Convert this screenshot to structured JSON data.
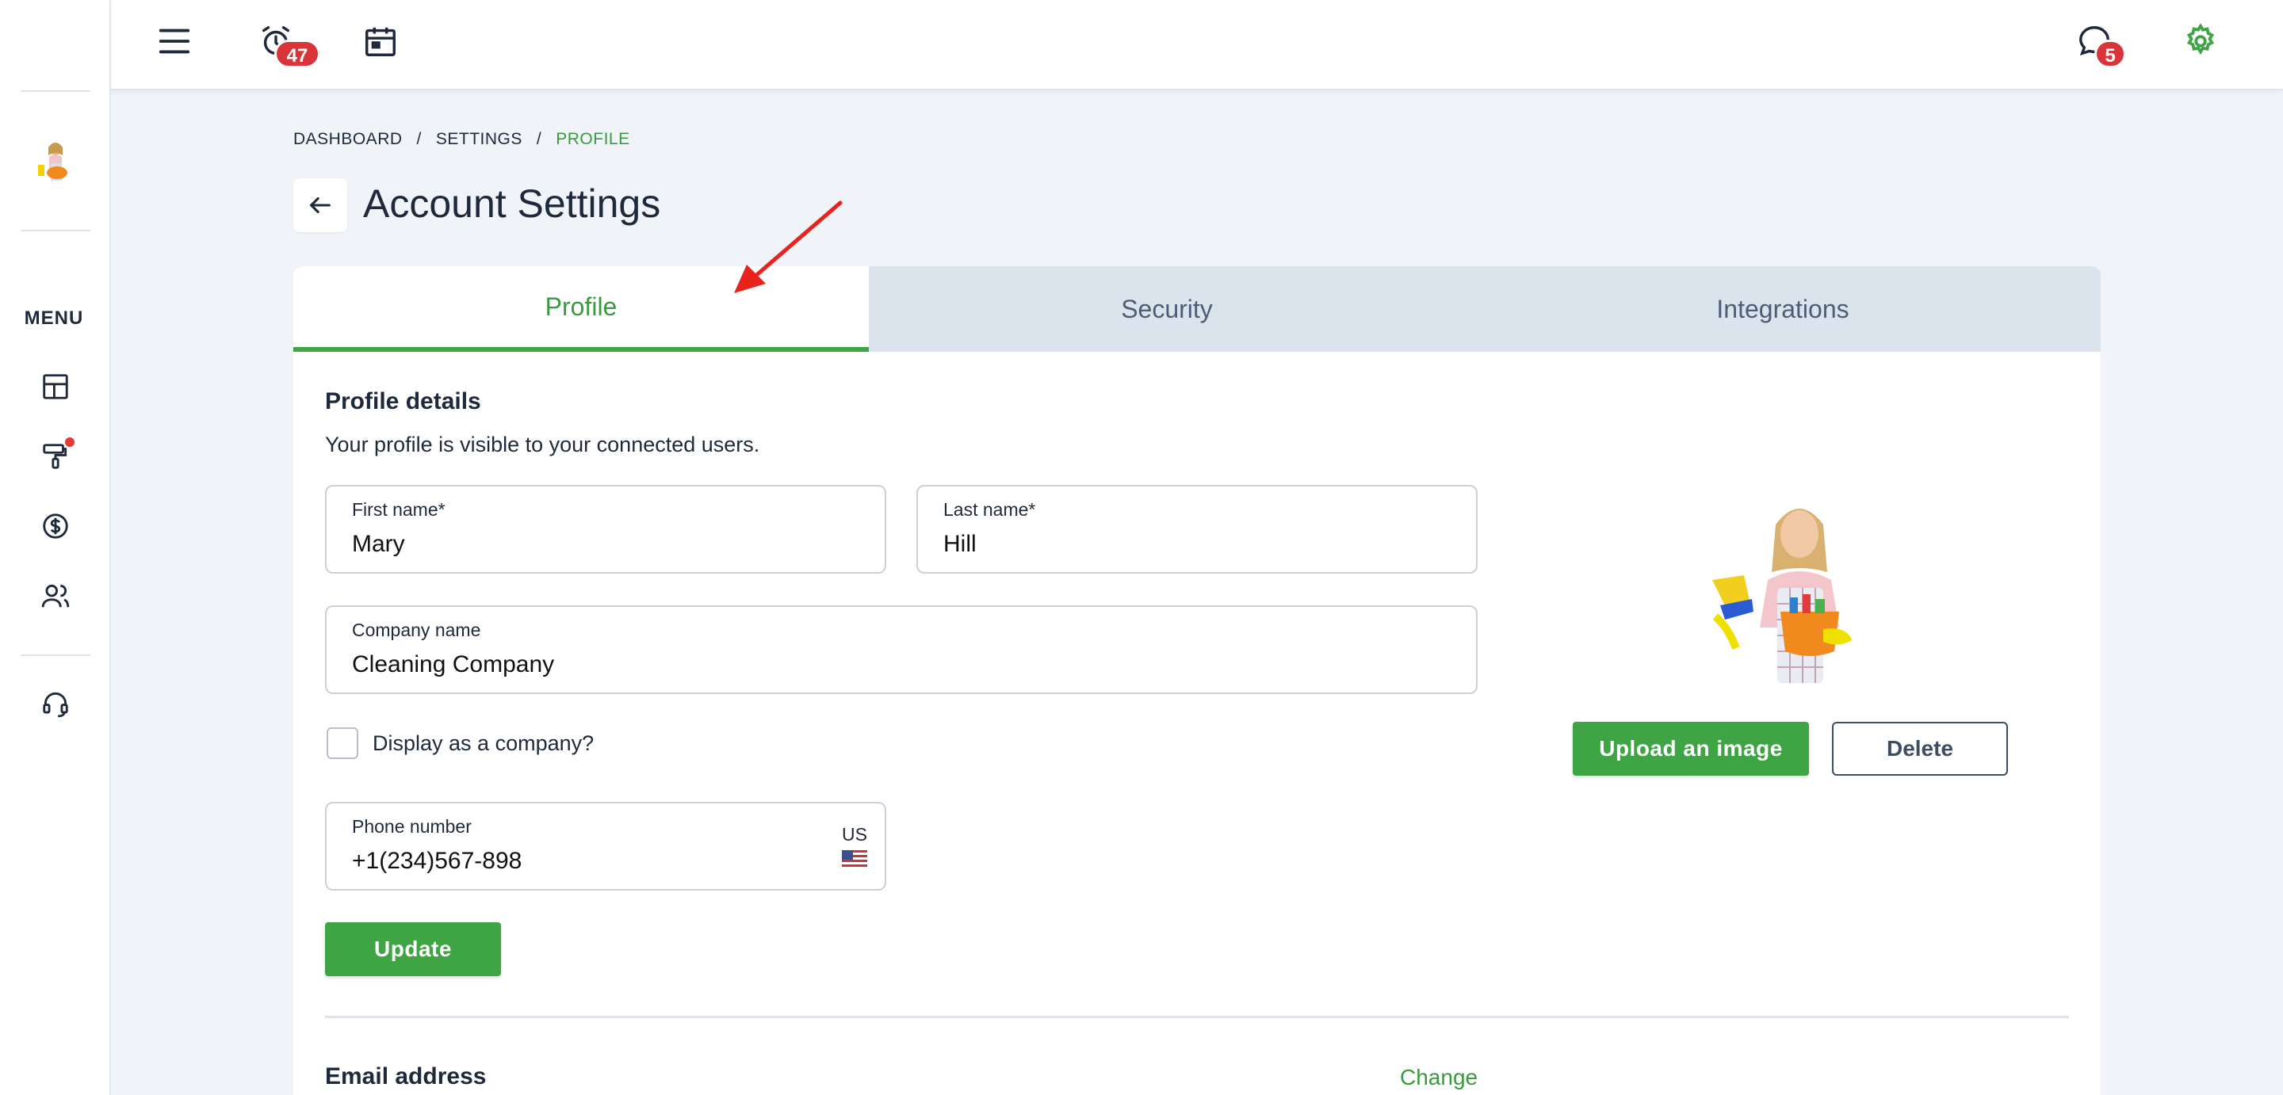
{
  "topbar": {
    "alarm_badge": "47",
    "chat_badge": "5"
  },
  "sidebar": {
    "menu_label": "MENU"
  },
  "breadcrumb": {
    "items": [
      "DASHBOARD",
      "SETTINGS",
      "PROFILE"
    ],
    "separator": "/"
  },
  "page": {
    "title": "Account Settings"
  },
  "tabs": [
    {
      "label": "Profile",
      "active": true
    },
    {
      "label": "Security",
      "active": false
    },
    {
      "label": "Integrations",
      "active": false
    }
  ],
  "profile": {
    "section_title": "Profile details",
    "section_desc": "Your profile is visible to your connected users.",
    "first_name_label": "First name*",
    "first_name_value": "Mary",
    "last_name_label": "Last name*",
    "last_name_value": "Hill",
    "company_label": "Company name",
    "company_value": "Cleaning Company",
    "display_company_label": "Display as a company?",
    "display_company_checked": false,
    "phone_label": "Phone number",
    "phone_value": "+1(234)567-898",
    "phone_country": "US",
    "upload_label": "Upload an image",
    "delete_label": "Delete",
    "update_label": "Update"
  },
  "email": {
    "title": "Email address",
    "change_label": "Change"
  },
  "colors": {
    "accent_green": "#3fa544",
    "badge_red": "#d8343a",
    "tab_bg": "#dbe3ec",
    "text_dark": "#1e2a3b"
  }
}
